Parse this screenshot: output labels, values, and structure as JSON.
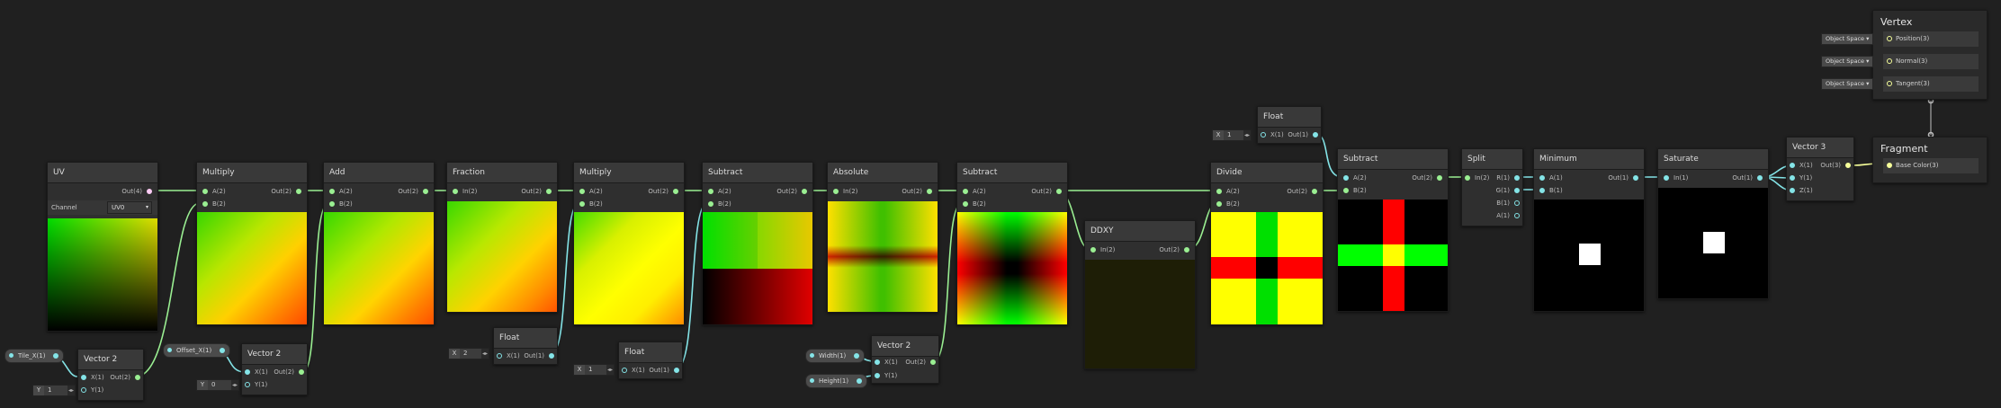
{
  "nodes": {
    "uv": {
      "title": "UV",
      "out": "Out(4)",
      "channel_label": "Channel",
      "channel_value": "UV0"
    },
    "multiply1": {
      "title": "Multiply",
      "in_a": "A(2)",
      "in_b": "B(2)",
      "out": "Out(2)"
    },
    "add": {
      "title": "Add",
      "in_a": "A(2)",
      "in_b": "B(2)",
      "out": "Out(2)"
    },
    "fraction": {
      "title": "Fraction",
      "in": "In(2)",
      "out": "Out(2)"
    },
    "multiply2": {
      "title": "Multiply",
      "in_a": "A(2)",
      "in_b": "B(2)",
      "out": "Out(2)"
    },
    "subtract1": {
      "title": "Subtract",
      "in_a": "A(2)",
      "in_b": "B(2)",
      "out": "Out(2)"
    },
    "absolute": {
      "title": "Absolute",
      "in": "In(2)",
      "out": "Out(2)"
    },
    "subtract2": {
      "title": "Subtract",
      "in_a": "A(2)",
      "in_b": "B(2)",
      "out": "Out(2)"
    },
    "ddxy": {
      "title": "DDXY",
      "in": "In(2)",
      "out": "Out(2)"
    },
    "divide": {
      "title": "Divide",
      "in_a": "A(2)",
      "in_b": "B(2)",
      "out": "Out(2)"
    },
    "subtract3": {
      "title": "Subtract",
      "in_a": "A(2)",
      "in_b": "B(2)",
      "out": "Out(2)"
    },
    "split": {
      "title": "Split",
      "in": "In(2)",
      "r": "R(1)",
      "g": "G(1)",
      "b": "B(1)",
      "a": "A(1)"
    },
    "minimum": {
      "title": "Minimum",
      "in_a": "A(1)",
      "in_b": "B(1)",
      "out": "Out(1)"
    },
    "saturate": {
      "title": "Saturate",
      "in": "In(1)",
      "out": "Out(1)"
    },
    "vector3_out": {
      "title": "Vector 3",
      "x": "X(1)",
      "y": "Y(1)",
      "z": "Z(1)",
      "out": "Out(3)"
    },
    "vector2_tile": {
      "title": "Vector 2",
      "x": "X(1)",
      "y": "Y(1)",
      "out": "Out(2)",
      "y_field_label": "Y",
      "y_field_value": "1"
    },
    "vector2_offset": {
      "title": "Vector 2",
      "x": "X(1)",
      "y": "Y(1)",
      "out": "Out(2)",
      "y_field_label": "Y",
      "y_field_value": "0"
    },
    "float1": {
      "title": "Float",
      "x": "X(1)",
      "out": "Out(1)",
      "field_label": "X",
      "field_value": "2"
    },
    "float2": {
      "title": "Float",
      "x": "X(1)",
      "out": "Out(1)",
      "field_label": "X",
      "field_value": "1"
    },
    "vector2_size": {
      "title": "Vector 2",
      "x": "X(1)",
      "y": "Y(1)",
      "out": "Out(2)"
    },
    "float3": {
      "title": "Float",
      "x": "X(1)",
      "out": "Out(1)",
      "field_label": "X",
      "field_value": "1"
    }
  },
  "properties": {
    "tile": "Tile_X(1)",
    "offset": "Offset_X(1)",
    "width": "Width(1)",
    "height": "Height(1)"
  },
  "master": {
    "vertex_title": "Vertex",
    "fragment_title": "Fragment",
    "vertex_slots": [
      {
        "space": "Object Space",
        "label": "Position(3)"
      },
      {
        "space": "Object Space",
        "label": "Normal(3)"
      },
      {
        "space": "Object Space",
        "label": "Tangent(3)"
      }
    ],
    "fragment_slot": "Base Color(3)"
  },
  "colors": {
    "background": "#202020",
    "node_body": "#2f2f2f",
    "node_header": "#393939",
    "wire_vec2": "#9aef92",
    "wire_vec1": "#84e4e7",
    "wire_vec3": "#f6ff9a"
  }
}
